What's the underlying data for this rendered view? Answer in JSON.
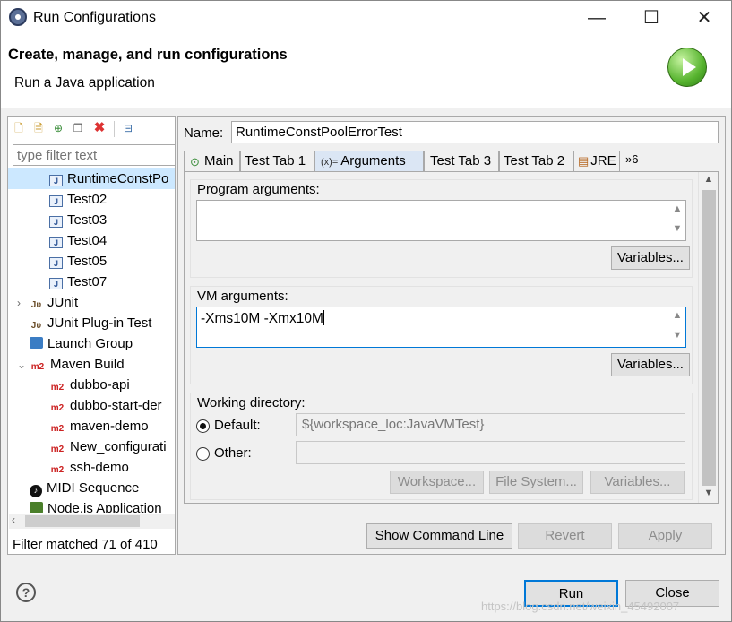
{
  "window": {
    "title": "Run Configurations",
    "min_glyph": "—",
    "max_glyph": "☐",
    "close_glyph": "✕"
  },
  "header": {
    "title": "Create, manage, and run configurations",
    "subtitle": "Run a Java application"
  },
  "left": {
    "filter_placeholder": "type filter text",
    "tree": [
      {
        "label": "RuntimeConstPo",
        "icon": "java-app-icon",
        "indent": 2,
        "selected": true
      },
      {
        "label": "Test02",
        "icon": "java-app-icon",
        "indent": 2
      },
      {
        "label": "Test03",
        "icon": "java-app-icon",
        "indent": 2
      },
      {
        "label": "Test04",
        "icon": "java-app-icon",
        "indent": 2
      },
      {
        "label": "Test05",
        "icon": "java-app-icon",
        "indent": 2
      },
      {
        "label": "Test07",
        "icon": "java-app-icon",
        "indent": 2
      },
      {
        "label": "JUnit",
        "icon": "junit-icon",
        "indent": 1,
        "chevron": "›"
      },
      {
        "label": "JUnit Plug-in Test",
        "icon": "junit-icon",
        "indent": 1
      },
      {
        "label": "Launch Group",
        "icon": "launch-group-icon",
        "indent": 1
      },
      {
        "label": "Maven Build",
        "icon": "maven-icon",
        "indent": 1,
        "chevron": "⌄"
      },
      {
        "label": "dubbo-api",
        "icon": "maven-icon",
        "indent": 2
      },
      {
        "label": "dubbo-start-der",
        "icon": "maven-icon",
        "indent": 2
      },
      {
        "label": "maven-demo",
        "icon": "maven-icon",
        "indent": 2
      },
      {
        "label": "New_configurati",
        "icon": "maven-icon",
        "indent": 2
      },
      {
        "label": "ssh-demo",
        "icon": "maven-icon",
        "indent": 2
      },
      {
        "label": "MIDI Sequence",
        "icon": "midi-icon",
        "indent": 1
      },
      {
        "label": "Node.js Application",
        "icon": "node-icon",
        "indent": 1
      }
    ],
    "status": "Filter matched 71 of 410"
  },
  "main": {
    "name_label": "Name:",
    "name_value": "RuntimeConstPoolErrorTest",
    "tabs": [
      {
        "label": "Main",
        "icon": "main-tab-icon",
        "glyph": "⊙"
      },
      {
        "label": "Test Tab 1",
        "icon": ""
      },
      {
        "label": "Arguments",
        "icon": "arguments-tab-icon",
        "glyph": "(x)=",
        "active": true
      },
      {
        "label": "Test Tab 3",
        "icon": ""
      },
      {
        "label": "Test Tab 2",
        "icon": ""
      },
      {
        "label": "JRE",
        "icon": "jre-tab-icon",
        "glyph": "▤"
      }
    ],
    "more_tabs": "»6",
    "program_arguments": {
      "label": "Program arguments:",
      "value": "",
      "variables": "Variables..."
    },
    "vm_arguments": {
      "label": "VM arguments:",
      "value": "-Xms10M -Xmx10M",
      "variables": "Variables..."
    },
    "working_directory": {
      "label": "Working directory:",
      "default_label": "Default:",
      "default_value": "${workspace_loc:JavaVMTest}",
      "other_label": "Other:",
      "other_value": "",
      "selected": "default",
      "workspace_btn": "Workspace...",
      "filesystem_btn": "File System...",
      "variables_btn": "Variables..."
    },
    "show_command_line": "Show Command Line",
    "revert": "Revert",
    "apply": "Apply"
  },
  "footer": {
    "run": "Run",
    "close": "Close",
    "help": "?"
  },
  "watermark": "https://blog.csdn.net/weixin_45492007",
  "colors": {
    "accent": "#0078d7",
    "selection": "#cce8ff",
    "tab_active": "#dbe6f4",
    "maven": "#cc2222"
  }
}
